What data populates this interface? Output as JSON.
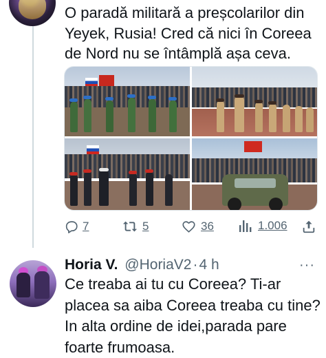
{
  "post": {
    "text": "O paradă militară a preșcolarilor din Yeyek, Rusia! Cred că nici în Coreea de Nord nu se întâmplă așa ceva.",
    "media_count": 4,
    "stats": {
      "replies": "7",
      "reposts": "5",
      "likes": "36",
      "views": "1.006"
    },
    "icons": [
      "reply-icon",
      "repost-icon",
      "like-icon",
      "views-icon",
      "share-icon"
    ]
  },
  "reply": {
    "author_name": "Horia V.",
    "handle": "@HoriaV2",
    "separator": "·",
    "time": "4 h",
    "more_label": "···",
    "text": "Ce treaba ai tu cu Coreea? Ti-ar placea sa aiba Coreea treaba cu tine? In alta ordine de idei,parada pare foarte frumoasa."
  },
  "colors": {
    "text": "#0f1419",
    "muted": "#536471",
    "thread_line": "#cfd9de"
  }
}
